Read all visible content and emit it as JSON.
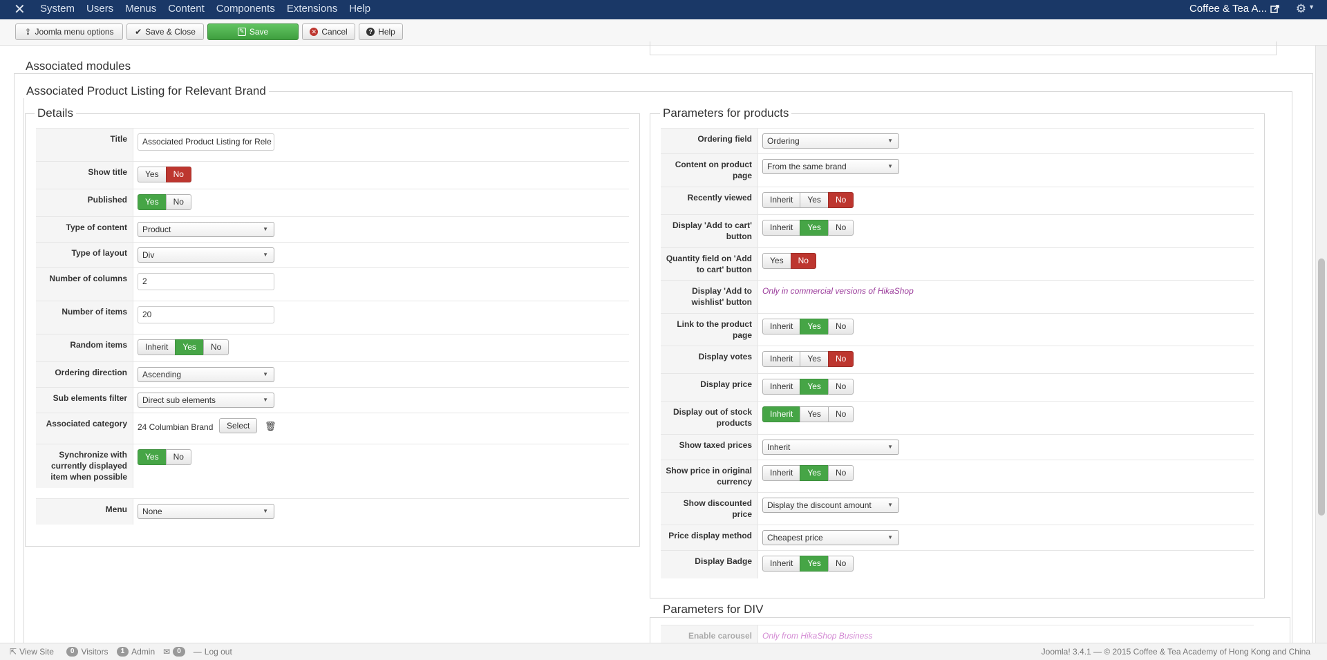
{
  "topnav": {
    "menu": [
      "System",
      "Users",
      "Menus",
      "Content",
      "Components",
      "Extensions",
      "Help"
    ],
    "site_name": "Coffee & Tea A..."
  },
  "toolbar": {
    "menu_options": "Joomla menu options",
    "save_close": "Save & Close",
    "save": "Save",
    "cancel": "Cancel",
    "help": "Help"
  },
  "sections": {
    "associated_modules": "Associated modules",
    "module_title": "Associated Product Listing for Relevant Brand",
    "details": "Details",
    "params_products": "Parameters for products",
    "params_div": "Parameters for DIV"
  },
  "details": {
    "title_label": "Title",
    "title_value": "Associated Product Listing for Rele",
    "show_title_label": "Show title",
    "published_label": "Published",
    "type_content_label": "Type of content",
    "type_content_value": "Product",
    "type_layout_label": "Type of layout",
    "type_layout_value": "Div",
    "num_columns_label": "Number of columns",
    "num_columns_value": "2",
    "num_items_label": "Number of items",
    "num_items_value": "20",
    "random_items_label": "Random items",
    "ordering_dir_label": "Ordering direction",
    "ordering_dir_value": "Ascending",
    "sub_filter_label": "Sub elements filter",
    "sub_filter_value": "Direct sub elements",
    "assoc_cat_label": "Associated category",
    "assoc_cat_value": "24 Columbian Brand",
    "select_btn": "Select",
    "sync_label": "Synchronize with currently displayed item when possible",
    "menu_label": "Menu",
    "menu_value": "None"
  },
  "opts": {
    "inherit": "Inherit",
    "yes": "Yes",
    "no": "No"
  },
  "products": {
    "ordering_field_label": "Ordering field",
    "ordering_field_value": "Ordering",
    "content_page_label": "Content on product page",
    "content_page_value": "From the same brand",
    "recently_viewed_label": "Recently viewed",
    "add_cart_label": "Display 'Add to cart' button",
    "qty_field_label": "Quantity field on 'Add to cart' button",
    "wishlist_label": "Display 'Add to wishlist' button",
    "wishlist_note": "Only in commercial versions of HikaShop",
    "link_product_label": "Link to the product page",
    "votes_label": "Display votes",
    "price_label": "Display price",
    "out_stock_label": "Display out of stock products",
    "taxed_label": "Show taxed prices",
    "taxed_value": "Inherit",
    "orig_currency_label": "Show price in original currency",
    "discounted_label": "Show discounted price",
    "discounted_value": "Display the discount amount",
    "price_method_label": "Price display method",
    "price_method_value": "Cheapest price",
    "badge_label": "Display Badge"
  },
  "div": {
    "carousel_label": "Enable carousel",
    "carousel_note": "Only from HikaShop Business"
  },
  "footer": {
    "view_site": "View Site",
    "visitors_count": "0",
    "visitors": "Visitors",
    "admin_count": "1",
    "admin": "Admin",
    "msg_count": "0",
    "logout": "Log out",
    "copyright": "Joomla! 3.4.1  —  © 2015 Coffee & Tea Academy of Hong Kong and China"
  },
  "colors": {
    "navbar": "#1a3867",
    "green": "#46a546",
    "red": "#bd362f"
  }
}
